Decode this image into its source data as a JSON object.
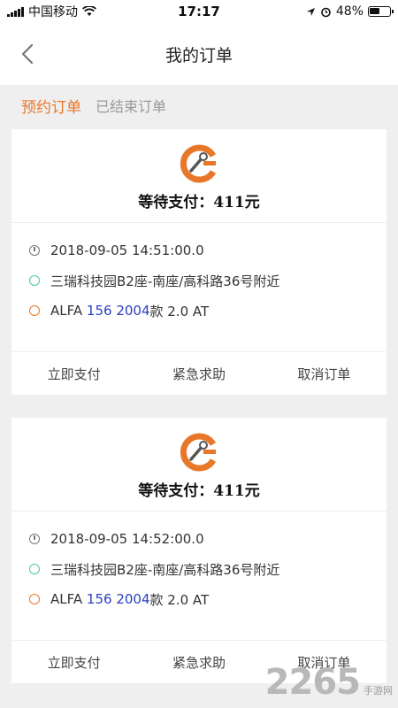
{
  "status_bar": {
    "carrier": "中国移动",
    "time": "17:17",
    "battery": "48%"
  },
  "header": {
    "title": "我的订单"
  },
  "tabs": [
    {
      "label": "预约订单",
      "active": true
    },
    {
      "label": "已结束订单",
      "active": false
    }
  ],
  "orders": [
    {
      "status": "等待支付：411元",
      "time": "2018-09-05 14:51:00.0",
      "location": "三瑞科技园B2座-南座/高科路36号附近",
      "car_brand": "ALFA",
      "car_model_num": "156 2004",
      "car_suffix": "款 2.0 AT",
      "actions": [
        "立即支付",
        "紧急求助",
        "取消订单"
      ]
    },
    {
      "status": "等待支付：411元",
      "time": "2018-09-05 14:52:00.0",
      "location": "三瑞科技园B2座-南座/高科路36号附近",
      "car_brand": "ALFA",
      "car_model_num": "156 2004",
      "car_suffix": "款 2.0 AT",
      "actions": [
        "立即支付",
        "紧急求助",
        "取消订单"
      ]
    }
  ],
  "watermark": {
    "number": "2265",
    "site": "手游网"
  },
  "colors": {
    "accent": "#e8772a",
    "green_dot": "#4cc9a4",
    "model_blue": "#2a3fbf",
    "background": "#efefef"
  }
}
